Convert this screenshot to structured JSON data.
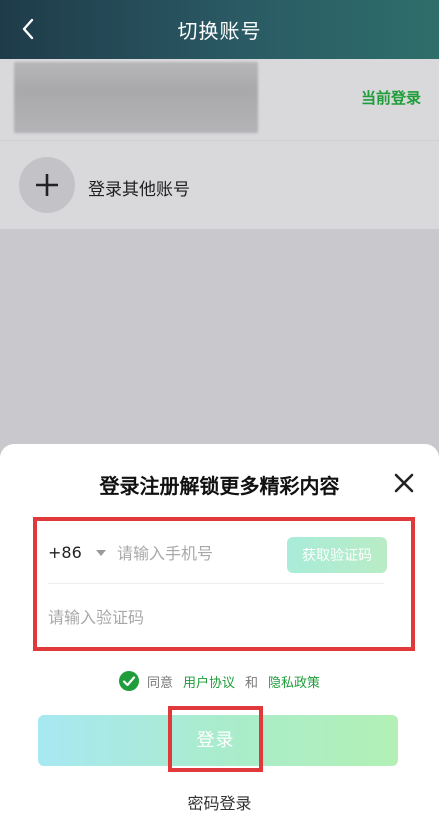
{
  "header": {
    "title": "切换账号"
  },
  "account": {
    "current_label": "当前登录"
  },
  "add_account": {
    "label": "登录其他账号"
  },
  "sheet": {
    "title": "登录注册解锁更多精彩内容",
    "country_code": "+86",
    "phone_placeholder": "请输入手机号",
    "get_code_label": "获取验证码",
    "code_placeholder": "请输入验证码",
    "agree_prefix": "同意",
    "user_agreement": "用户协议",
    "agree_and": "和",
    "privacy_policy": "隐私政策",
    "login_label": "登录",
    "password_login": "密码登录"
  },
  "colors": {
    "accent_green": "#1f9d3a",
    "highlight_red": "#e0393b",
    "header_start": "#1f3b4a",
    "header_end": "#2e6e6a"
  },
  "icons": [
    "back-arrow-icon",
    "plus-icon",
    "close-icon",
    "caret-down-icon",
    "check-circle-icon"
  ]
}
